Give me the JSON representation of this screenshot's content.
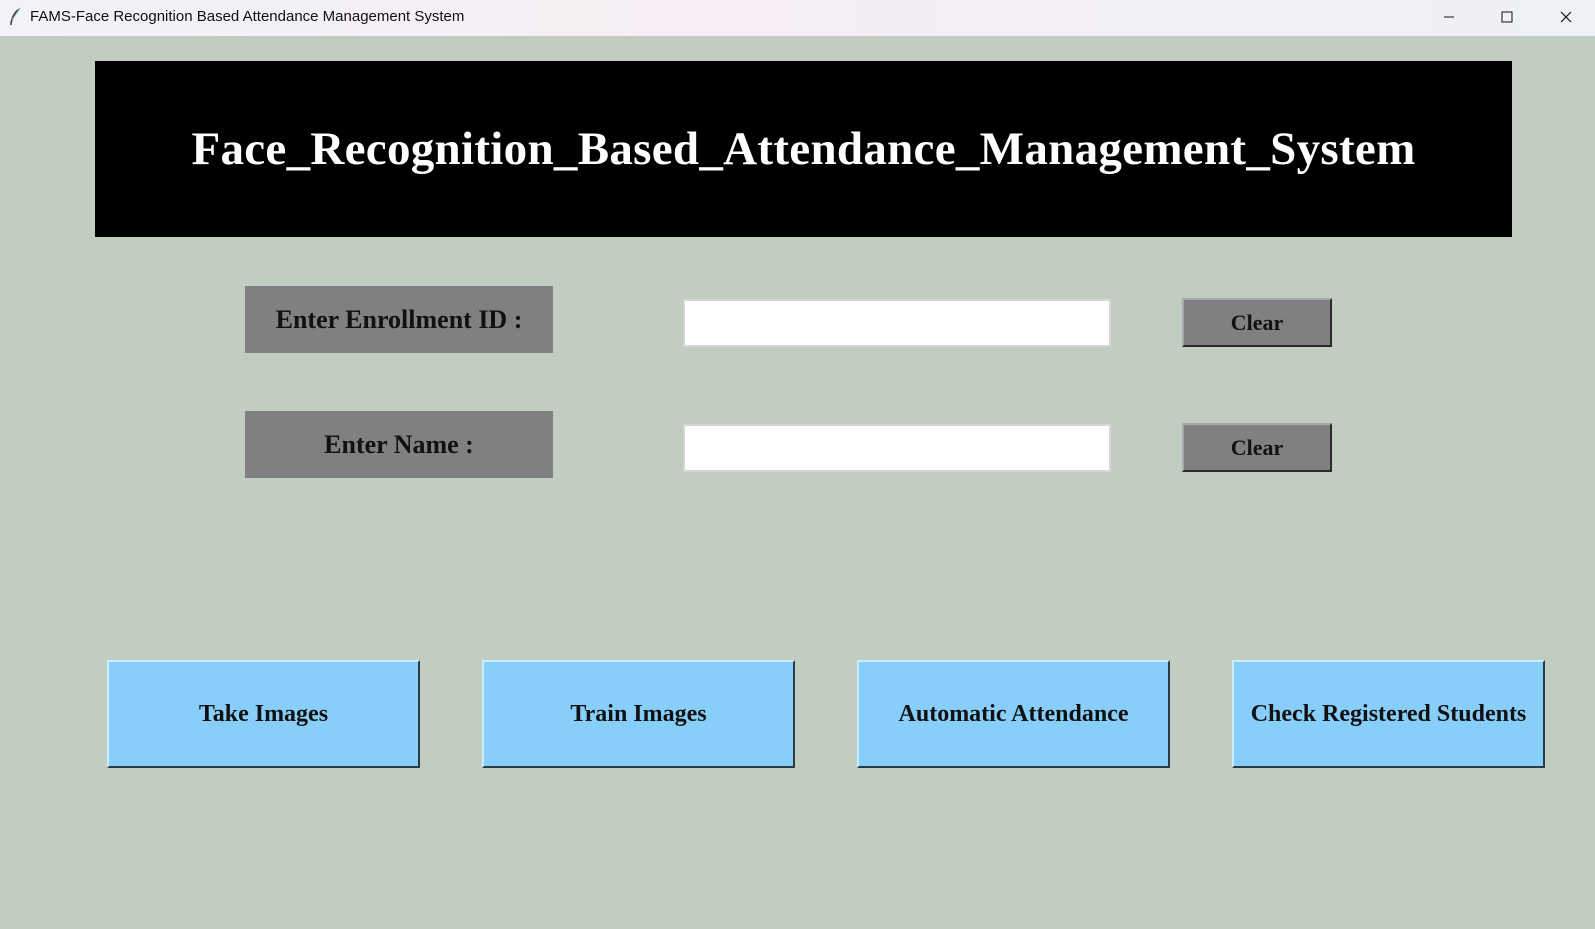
{
  "window": {
    "title": "FAMS-Face Recognition Based Attendance Management System",
    "icon": "feather-icon",
    "controls": [
      "minimize-icon",
      "maximize-icon",
      "close-icon"
    ]
  },
  "banner": {
    "title": "Face_Recognition_Based_Attendance_Management_System"
  },
  "form": {
    "enrollment": {
      "label": "Enter Enrollment ID :",
      "value": "",
      "clear_label": "Clear"
    },
    "name": {
      "label": "Enter Name :",
      "value": "",
      "clear_label": "Clear"
    }
  },
  "actions": {
    "take_images": "Take Images",
    "train_images": "Train Images",
    "automatic_attendance": "Automatic Attendance",
    "check_registered": "Check Registered Students"
  },
  "colors": {
    "background": "#c1cdc1",
    "banner": "#000000",
    "label_bg": "#808080",
    "action_button": "#87cefa"
  }
}
